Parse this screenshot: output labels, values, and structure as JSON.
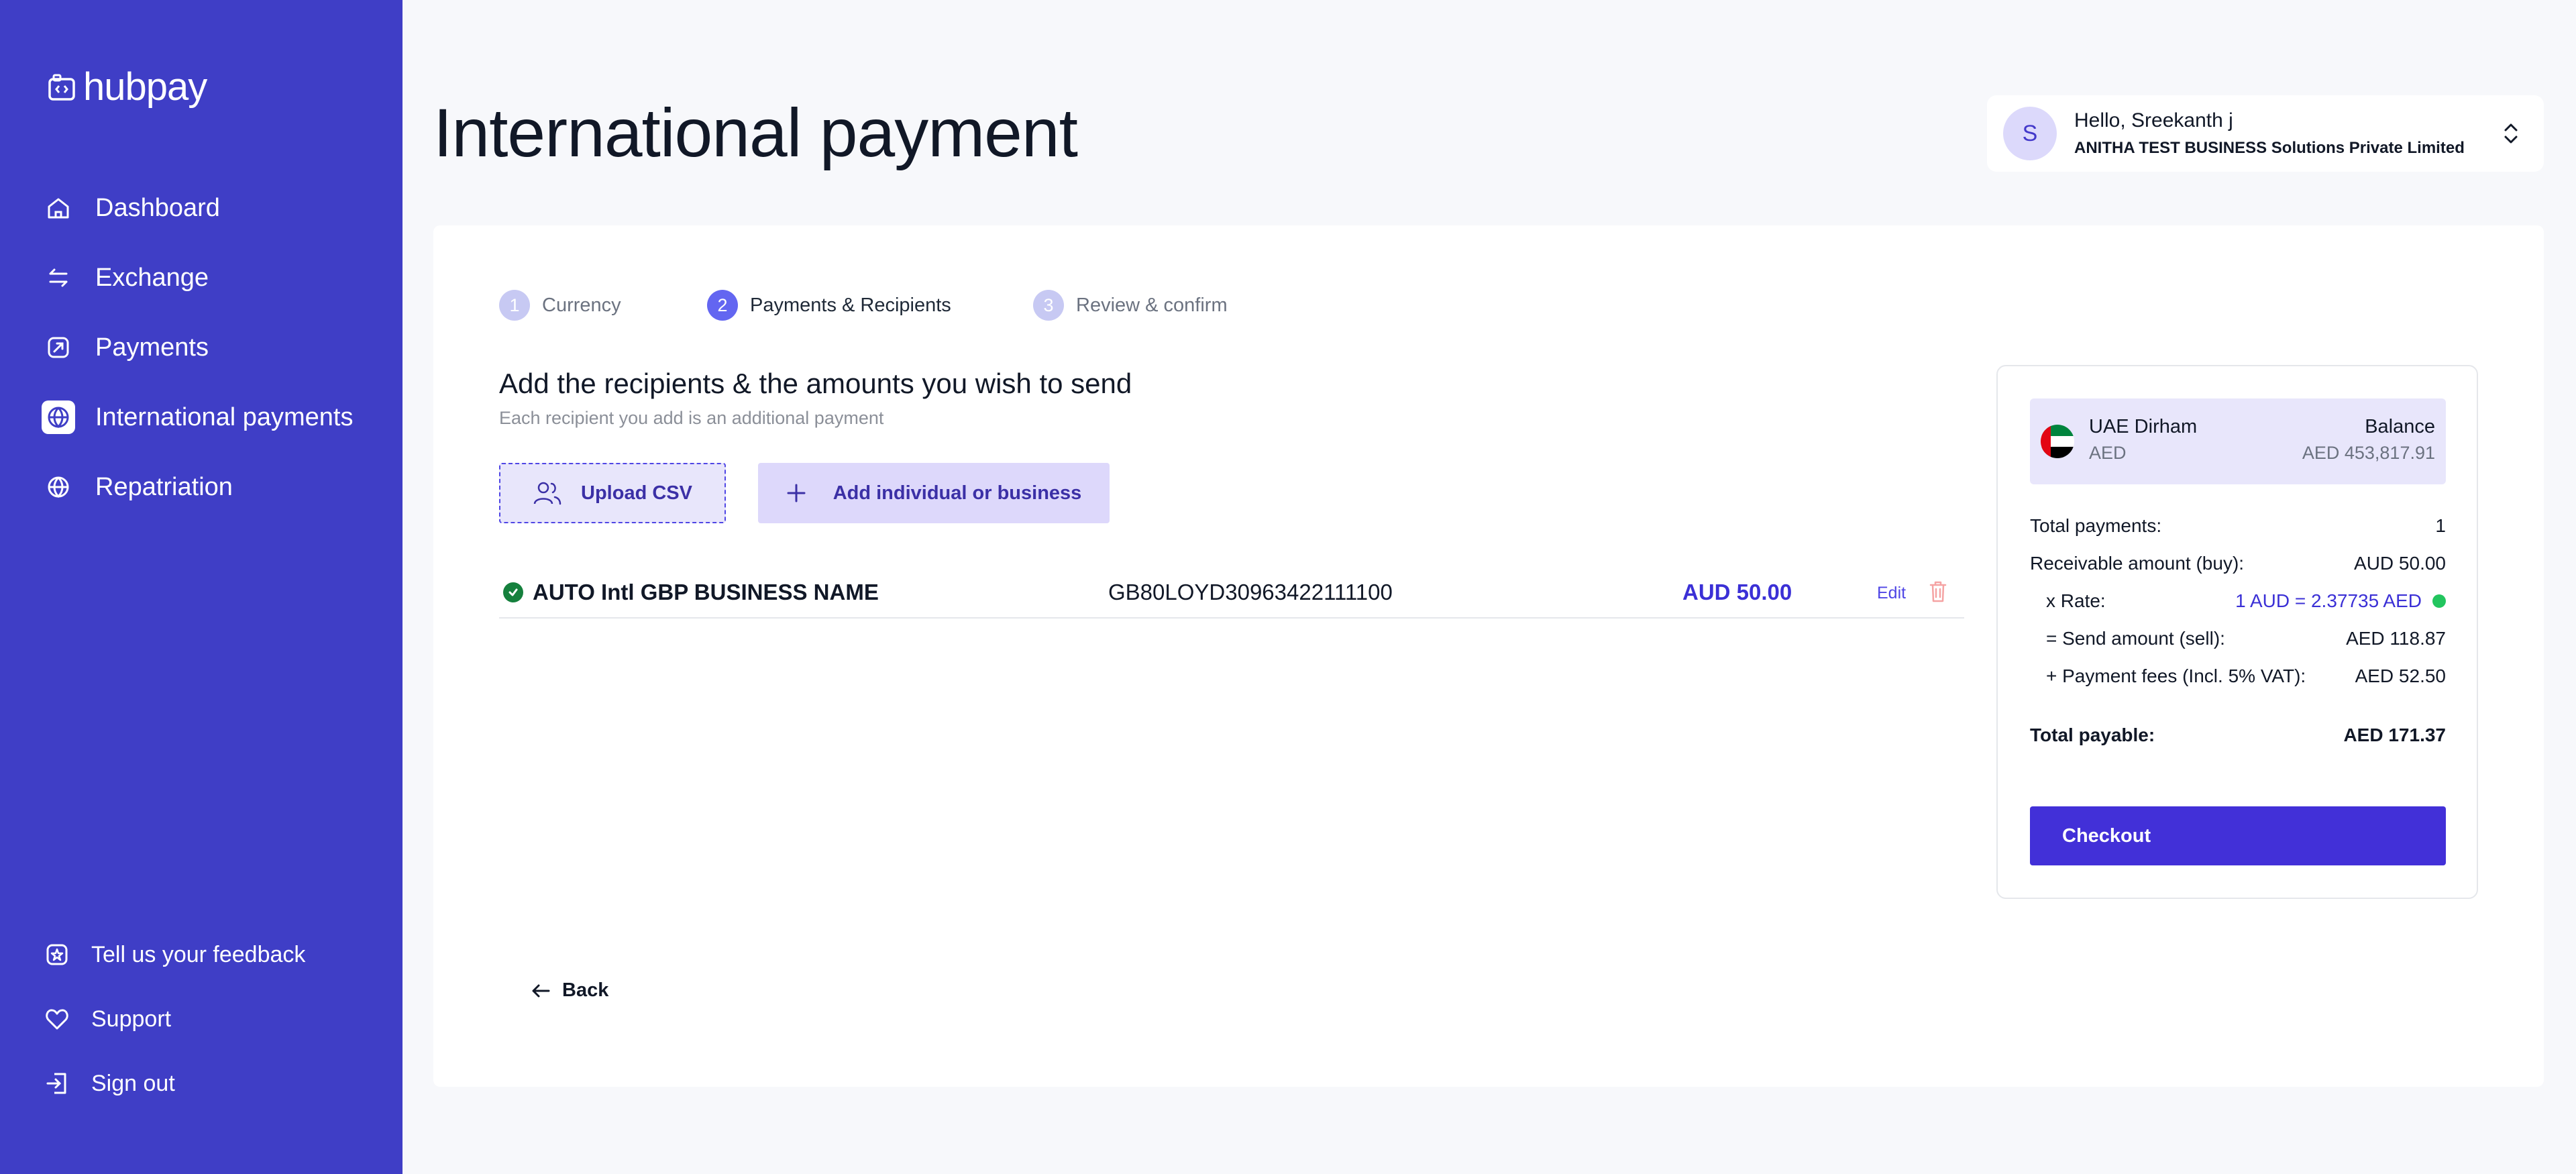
{
  "brand": {
    "name": "hubpay"
  },
  "sidebar": {
    "items": [
      {
        "label": "Dashboard",
        "icon": "home-icon"
      },
      {
        "label": "Exchange",
        "icon": "exchange-icon"
      },
      {
        "label": "Payments",
        "icon": "payments-icon"
      },
      {
        "label": "International payments",
        "icon": "globe-icon",
        "active": true
      },
      {
        "label": "Repatriation",
        "icon": "globe-icon"
      }
    ],
    "bottom_items": [
      {
        "label": "Tell us your feedback",
        "icon": "feedback-icon"
      },
      {
        "label": "Support",
        "icon": "heart-icon"
      },
      {
        "label": "Sign out",
        "icon": "sign-out-icon"
      }
    ]
  },
  "header": {
    "title": "International payment",
    "user": {
      "initial": "S",
      "greeting": "Hello, Sreekanth j",
      "company": "ANITHA TEST BUSINESS Solutions Private Limited"
    }
  },
  "steps": [
    {
      "number": "1",
      "label": "Currency",
      "state": "inactive"
    },
    {
      "number": "2",
      "label": "Payments & Recipients",
      "state": "active"
    },
    {
      "number": "3",
      "label": "Review & confirm",
      "state": "inactive"
    }
  ],
  "recipients_section": {
    "title": "Add the recipients & the amounts you wish to send",
    "subtitle": "Each recipient you add is an additional payment",
    "upload_label": "Upload CSV",
    "add_label": "Add individual or business",
    "rows": [
      {
        "name": "AUTO Intl GBP BUSINESS NAME",
        "iban": "GB80LOYD30963422111100",
        "amount": "AUD 50.00",
        "edit_label": "Edit"
      }
    ],
    "back_label": "Back"
  },
  "summary": {
    "wallet": {
      "currency_name": "UAE Dirham",
      "currency_code": "AED",
      "balance_label": "Balance",
      "balance_value": "AED 453,817.91"
    },
    "rows": [
      {
        "label": "Total payments:",
        "value": "1"
      },
      {
        "label": "Receivable amount (buy):",
        "value": "AUD 50.00"
      },
      {
        "label": "x Rate:",
        "value": "1 AUD = 2.37735 AED"
      },
      {
        "label": "= Send amount (sell):",
        "value": "AED 118.87"
      },
      {
        "label": "+ Payment fees (Incl. 5% VAT):",
        "value": "AED 52.50"
      }
    ],
    "total": {
      "label": "Total payable:",
      "value": "AED 171.37"
    },
    "checkout_label": "Checkout"
  },
  "colors": {
    "sidebar": "#3f3ec6",
    "accent": "#4230d8",
    "success": "#15803d",
    "rate_live": "#22c55e"
  }
}
